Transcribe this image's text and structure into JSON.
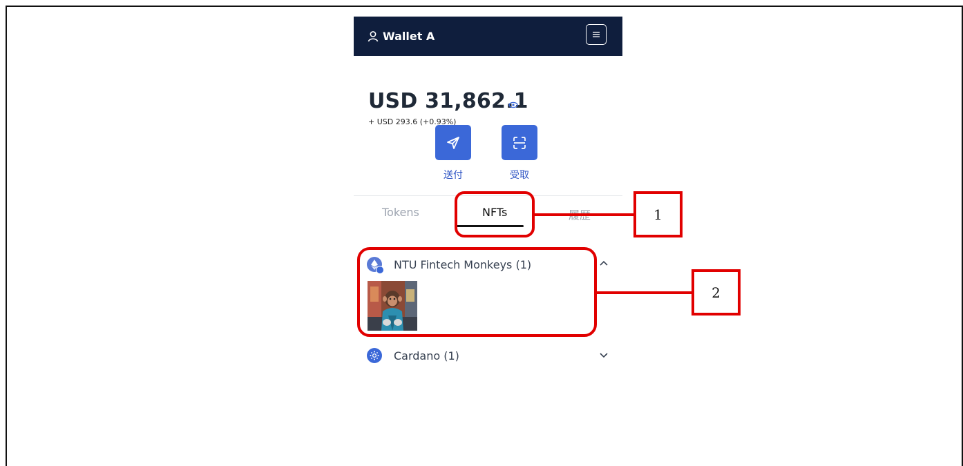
{
  "header": {
    "wallet_name": "Wallet A",
    "user_icon": "user-icon",
    "menu_icon": "menu-icon"
  },
  "balance": {
    "amount": "USD 31,862.1",
    "change": "+ USD 293.6 (+0.93%)",
    "visibility_icon": "eye-icon"
  },
  "actions": {
    "send_label": "送付",
    "receive_label": "受取"
  },
  "tabs": [
    {
      "label": "Tokens",
      "active": false
    },
    {
      "label": "NFTs",
      "active": true
    },
    {
      "label": "履歴",
      "active": false
    }
  ],
  "collections": [
    {
      "name": "NTU Fintech Monkeys (1)",
      "chain_icon": "ethereum-icon",
      "expanded": true
    },
    {
      "name": "Cardano (1)",
      "chain_icon": "cardano-icon",
      "expanded": false
    }
  ],
  "annotations": {
    "label_1": "1",
    "label_2": "2",
    "color": "#e10000"
  },
  "colors": {
    "header_bg": "#0f1e3d",
    "accent": "#3b68d8"
  }
}
